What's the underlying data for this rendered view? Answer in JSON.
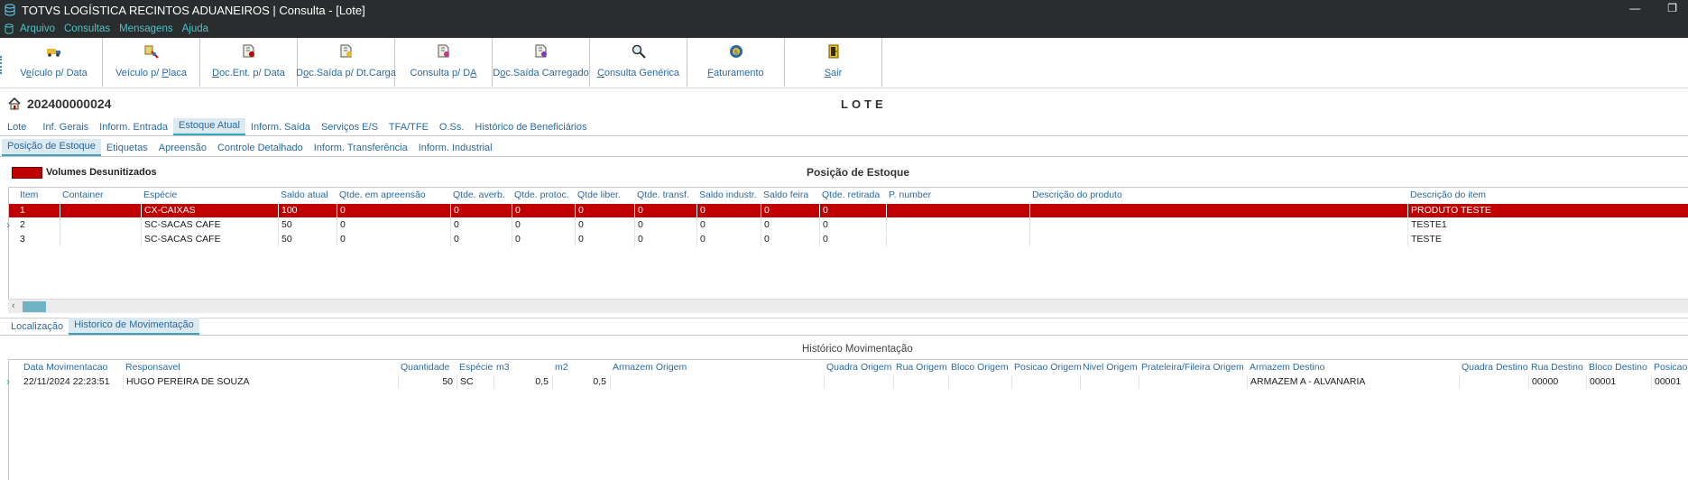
{
  "window": {
    "title": "TOTVS LOGÍSTICA RECINTOS ADUANEIROS | Consulta - [Lote]",
    "restore_icon": "restore-icon",
    "minimize_icon": "minimize-icon"
  },
  "menu": {
    "items": [
      "Arquivo",
      "Consultas",
      "Mensagens",
      "Ajuda"
    ]
  },
  "toolbar": {
    "buttons": [
      {
        "pre": "V",
        "u": "e",
        "post": "ículo p/ Data",
        "icon": "truck-icon"
      },
      {
        "pre": "Veículo p/ ",
        "u": "P",
        "post": "laca",
        "icon": "plate-icon"
      },
      {
        "pre": "",
        "u": "D",
        "post": "oc.Ent. p/ Data",
        "icon": "document-in-icon"
      },
      {
        "pre": "D",
        "u": "o",
        "post": "c.Saída p/ Dt.Carga",
        "icon": "document-out-icon"
      },
      {
        "pre": "Consulta p/ D",
        "u": "A",
        "post": "",
        "icon": "document-da-icon"
      },
      {
        "pre": "D",
        "u": "o",
        "post": "c.Saída Carregado",
        "icon": "loaded-icon"
      },
      {
        "pre": "",
        "u": "C",
        "post": "onsulta Genérica",
        "icon": "magnifier-icon"
      },
      {
        "pre": "",
        "u": "F",
        "post": "aturamento",
        "icon": "billing-icon"
      },
      {
        "pre": "",
        "u": "S",
        "post": "air",
        "icon": "exit-door-icon"
      }
    ]
  },
  "header": {
    "lot_number": "202400000024",
    "screen_title": "LOTE"
  },
  "tabs_main": [
    "Lote",
    "Inf. Gerais",
    "Inform. Entrada",
    "Estoque Atual",
    "Inform. Saída",
    "Serviços E/S",
    "TFA/TFE",
    "O.Ss.",
    "Histórico de Beneficiários"
  ],
  "tabs_main_active": "Estoque Atual",
  "tabs_sub": [
    "Posição de Estoque",
    "Etiquetas",
    "Apreensão",
    "Controle Detalhado",
    "Inform. Transferência",
    "Inform. Industrial"
  ],
  "tabs_sub_active": "Posição de Estoque",
  "stock": {
    "legend_label": "Volumes Desunitizados",
    "legend_color": "#c00000",
    "title": "Posição de Estoque",
    "columns": [
      "Item",
      "Container",
      "Espécie",
      "Saldo atual",
      "Qtde. em apreensão",
      "Qtde. averb.",
      "Qtde. protoc.",
      "Qtde liber.",
      "Qtde. transf.",
      "Saldo industr.",
      "Saldo feira",
      "Qtde. retirada",
      "P. number",
      "Descrição do produto",
      "Descrição do item"
    ],
    "rows": [
      [
        "1",
        "",
        "CX-CAIXAS",
        "100",
        "0",
        "0",
        "0",
        "0",
        "0",
        "0",
        "0",
        "0",
        "",
        "",
        "PRODUTO TESTE"
      ],
      [
        "2",
        "",
        "SC-SACAS CAFE",
        "50",
        "0",
        "0",
        "0",
        "0",
        "0",
        "0",
        "0",
        "0",
        "",
        "",
        "TESTE1"
      ],
      [
        "3",
        "",
        "SC-SACAS CAFE",
        "50",
        "0",
        "0",
        "0",
        "0",
        "0",
        "0",
        "0",
        "0",
        "",
        "",
        "TESTE"
      ]
    ]
  },
  "tabs_bottom": [
    "Localização",
    "Historico de Movimentação"
  ],
  "tabs_bottom_active": "Historico de Movimentação",
  "history": {
    "title": "Histórico Movimentação",
    "columns": [
      "Data Movimentacao",
      "Responsavel",
      "Quantidade",
      "Espécie",
      "m3",
      "m2",
      "Armazem Origem",
      "Quadra Origem",
      "Rua Origem",
      "Bloco Origem",
      "Posicao Origem",
      "Nivel Origem",
      "Prateleira/Fileira Origem",
      "Armazem Destino",
      "Quadra Destino",
      "Rua Destino",
      "Bloco Destino",
      "Posicao"
    ],
    "rows": [
      [
        "22/11/2024 22:23:51",
        "HUGO PEREIRA DE SOUZA",
        "50",
        "SC",
        "0,5",
        "0,5",
        "",
        "",
        "",
        "",
        "",
        "",
        "",
        "ARMAZEM A - ALVANARIA",
        "",
        "00000",
        "00001",
        "00001"
      ]
    ]
  }
}
